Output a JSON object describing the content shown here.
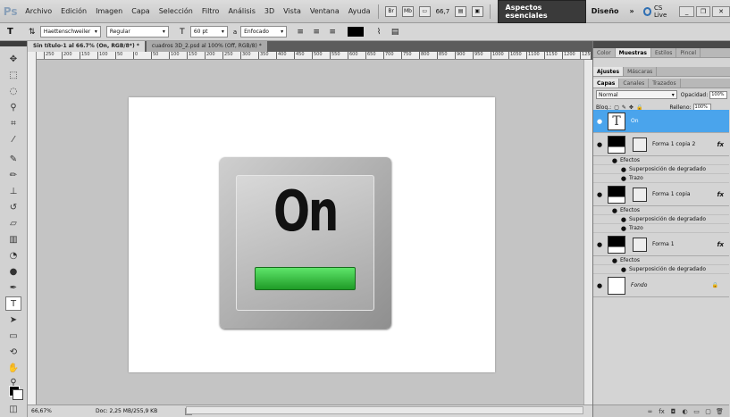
{
  "menubar": {
    "logo": "Ps",
    "items": [
      "Archivo",
      "Edición",
      "Imagen",
      "Capa",
      "Selección",
      "Filtro",
      "Análisis",
      "3D",
      "Vista",
      "Ventana",
      "Ayuda"
    ],
    "zoom": "66,7",
    "workspace": "Aspectos esenciales",
    "diseno": "Diseño",
    "more": "»",
    "cslive": "CS Live"
  },
  "options": {
    "tool_glyph": "T",
    "font_family": "Haettenschweiler",
    "font_style": "Regular",
    "font_size": "60 pt",
    "aa_label": "a",
    "antialias": "Enfocado"
  },
  "documents": {
    "tabs": [
      "Sin título-1 al 66.7% (On, RGB/8*) *",
      "cuadros 3D_2.psd al 100% (Off, RGB/8) *"
    ],
    "ruler_ticks": [
      "250",
      "200",
      "150",
      "100",
      "50",
      "0",
      "50",
      "100",
      "150",
      "200",
      "250",
      "300",
      "350",
      "400",
      "450",
      "500",
      "550",
      "600",
      "650",
      "700",
      "750",
      "800",
      "850",
      "900",
      "950",
      "1000",
      "1050",
      "1100",
      "1150",
      "1200",
      "1250"
    ]
  },
  "canvas": {
    "button_text": "On"
  },
  "status": {
    "zoom": "66,67%",
    "doc": "Doc: 2,25 MB/255,9 KB"
  },
  "panels": {
    "top_tabs": [
      "Color",
      "Muestras",
      "Estilos",
      "Pincel"
    ],
    "mid_tabs": [
      "Ajustes",
      "Máscaras"
    ],
    "layer_tabs": [
      "Capas",
      "Canales",
      "Trazados"
    ],
    "blend_mode": "Normal",
    "opacity_label": "Opacidad:",
    "opacity": "100%",
    "lock_label": "Bloq.:",
    "fill_label": "Relleno:",
    "fill": "100%",
    "layers": [
      {
        "name": "On",
        "type": "text"
      },
      {
        "name": "Forma 1 copia 2",
        "type": "shape",
        "effects_label": "Efectos",
        "effects": [
          "Superposición de degradado",
          "Trazo"
        ]
      },
      {
        "name": "Forma 1 copia",
        "type": "shape",
        "effects_label": "Efectos",
        "effects": [
          "Superposición de degradado",
          "Trazo"
        ]
      },
      {
        "name": "Forma 1",
        "type": "shape",
        "effects_label": "Efectos",
        "effects": [
          "Superposición de degradado"
        ]
      },
      {
        "name": "Fondo",
        "type": "background"
      }
    ],
    "fx": "fx"
  }
}
